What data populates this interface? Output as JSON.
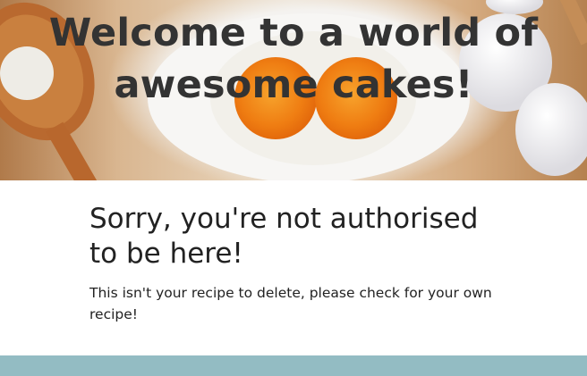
{
  "hero": {
    "title_line1": "Welcome to a world of",
    "title_line2": "awesome cakes!"
  },
  "message": {
    "heading": "Sorry, you're not authorised to be here!",
    "body": "This isn't your recipe to delete, please check for your own recipe!"
  },
  "colors": {
    "footer": "#93bcc3",
    "title_text": "#333333",
    "body_text": "#222222"
  }
}
